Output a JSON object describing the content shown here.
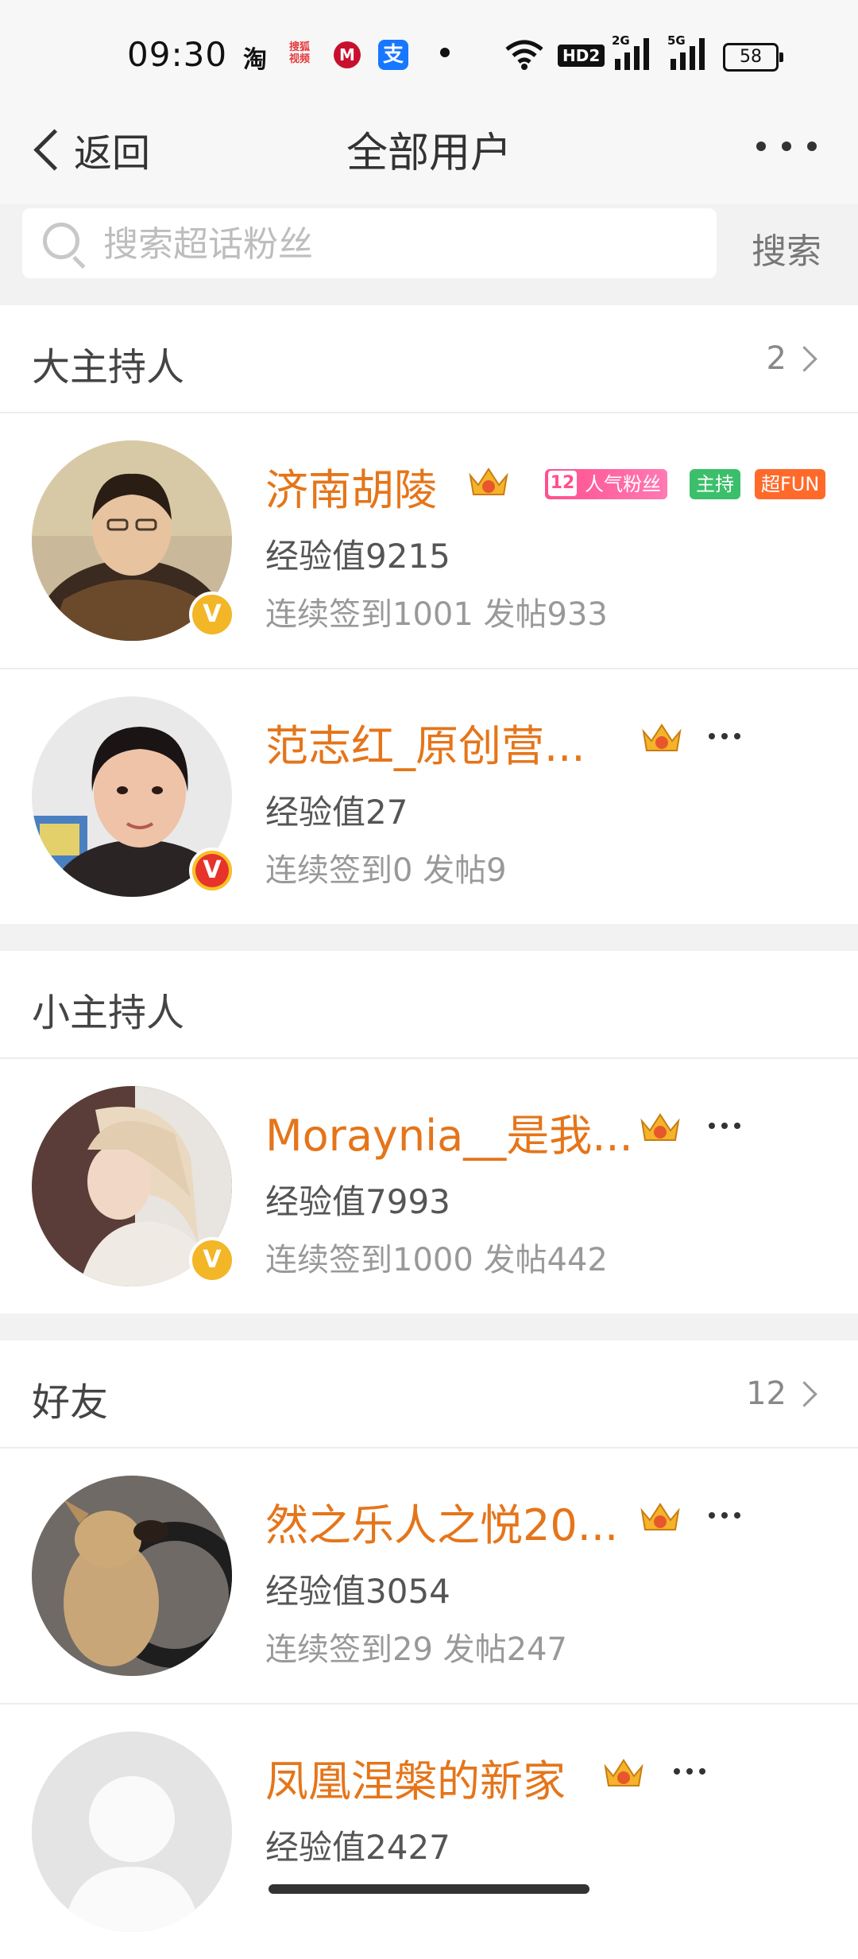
{
  "status_bar": {
    "time": "09:30",
    "app_icons": [
      "taobao-icon",
      "sohu-video-icon",
      "cmb-icon",
      "alipay-icon"
    ],
    "taobao_glyph": "淘",
    "sohu_label": "搜狐视频",
    "cmb_glyph": "M",
    "alipay_glyph": "支",
    "hd_label": "HD2",
    "sig1_label": "2G",
    "sig2_label": "5G",
    "battery": "58"
  },
  "nav": {
    "back_label": "返回",
    "title": "全部用户"
  },
  "search": {
    "placeholder": "搜索超话粉丝",
    "value": "",
    "button_label": "搜索"
  },
  "sections": [
    {
      "title": "大主持人",
      "count": "2",
      "users": [
        {
          "name": "济南胡陵",
          "experience": "经验值9215",
          "stats": "连续签到1001 发帖933",
          "badge_level": "12",
          "fan_tag": "人气粉丝",
          "host_tag": "主持",
          "fun_tag": "超FUN",
          "verified": "gold"
        },
        {
          "name": "范志红_原创营...",
          "experience": "经验值27",
          "stats": "连续签到0 发帖9",
          "verified": "red"
        }
      ]
    },
    {
      "title": "小主持人",
      "users": [
        {
          "name": "Moraynia__是我...",
          "experience": "经验值7993",
          "stats": "连续签到1000 发帖442",
          "verified": "gold"
        }
      ]
    },
    {
      "title": "好友",
      "count": "12",
      "users": [
        {
          "name": "然之乐人之悦20...",
          "experience": "经验值3054",
          "stats": "连续签到29 发帖247"
        },
        {
          "name": "凤凰涅槃的新家",
          "experience": "经验值2427",
          "stats": ""
        }
      ]
    }
  ],
  "colors": {
    "name": "#e5751a",
    "verified_gold": "#f2b627",
    "verified_red": "#e8332b",
    "fan_tag": "#ff4f8e",
    "host_tag": "#3bbf6b",
    "fun_tag": "#ff6a2b"
  }
}
